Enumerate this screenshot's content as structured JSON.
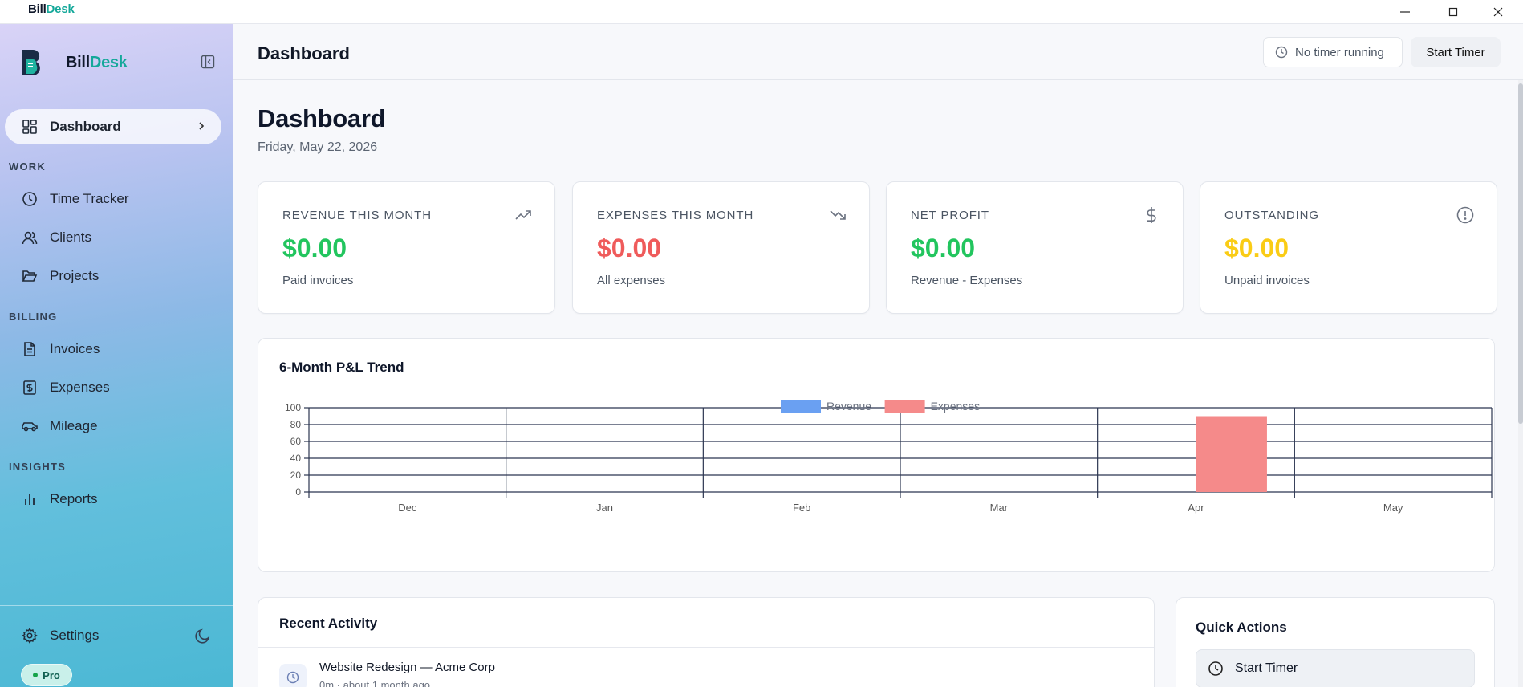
{
  "window": {
    "app_name_prefix": "Bill",
    "app_name_suffix": "Desk"
  },
  "sidebar": {
    "brand_prefix": "Bill",
    "brand_suffix": "Desk",
    "items": {
      "dashboard": "Dashboard",
      "time_tracker": "Time Tracker",
      "clients": "Clients",
      "projects": "Projects",
      "invoices": "Invoices",
      "expenses": "Expenses",
      "mileage": "Mileage",
      "reports": "Reports"
    },
    "sections": {
      "work": "WORK",
      "billing": "BILLING",
      "insights": "INSIGHTS"
    },
    "settings_label": "Settings",
    "plan_badge": "Pro"
  },
  "header": {
    "title": "Dashboard",
    "timer_status": "No timer running",
    "start_timer": "Start Timer"
  },
  "page": {
    "heading": "Dashboard",
    "date": "Friday, May 22, 2026"
  },
  "stats": [
    {
      "label": "REVENUE THIS MONTH",
      "value": "$0.00",
      "sub": "Paid invoices",
      "color": "#22c55e",
      "icon": "trending-up-icon"
    },
    {
      "label": "EXPENSES THIS MONTH",
      "value": "$0.00",
      "sub": "All expenses",
      "color": "#ef5b5b",
      "icon": "trending-down-icon"
    },
    {
      "label": "NET PROFIT",
      "value": "$0.00",
      "sub": "Revenue - Expenses",
      "color": "#22c55e",
      "icon": "dollar-icon"
    },
    {
      "label": "OUTSTANDING",
      "value": "$0.00",
      "sub": "Unpaid invoices",
      "color": "#facc15",
      "icon": "alert-circle-icon"
    }
  ],
  "chart": {
    "title": "6-Month P&L Trend"
  },
  "chart_data": {
    "type": "bar",
    "categories": [
      "Dec",
      "Jan",
      "Feb",
      "Mar",
      "Apr",
      "May"
    ],
    "series": [
      {
        "name": "Revenue",
        "values": [
          0,
          0,
          0,
          0,
          0,
          0
        ],
        "color": "#6aa0f2"
      },
      {
        "name": "Expenses",
        "values": [
          0,
          0,
          0,
          0,
          90,
          0
        ],
        "color": "#f58a8a"
      }
    ],
    "ylim": [
      0,
      100
    ],
    "yticks": [
      0,
      20,
      40,
      60,
      80,
      100
    ],
    "grid": true,
    "legend": "top-center"
  },
  "activity": {
    "title": "Recent Activity",
    "items": [
      {
        "title": "Website Redesign — Acme Corp",
        "meta": "0m · about 1 month ago"
      }
    ]
  },
  "quick_actions": {
    "title": "Quick Actions",
    "start_timer": "Start Timer"
  }
}
